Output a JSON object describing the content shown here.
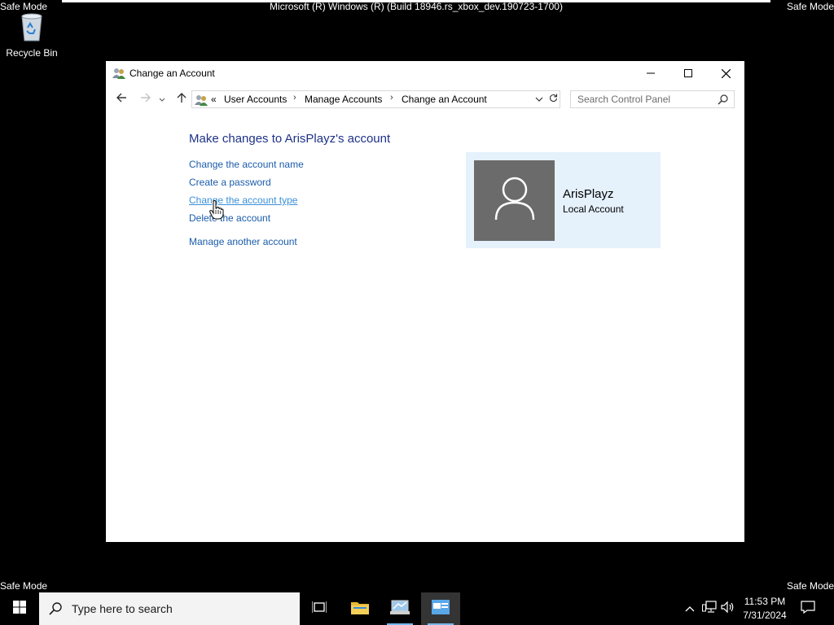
{
  "desktop": {
    "safe_mode_label": "Safe Mode",
    "build_text": "Microsoft (R) Windows (R) (Build 18946.rs_xbox_dev.190723-1700)",
    "recycle_bin_label": "Recycle Bin"
  },
  "window": {
    "title": "Change an Account",
    "controls": {
      "minimize_icon": "minimize-icon",
      "maximize_icon": "maximize-icon",
      "close_icon": "close-icon"
    },
    "address_bar": {
      "overflow_chevron": "«",
      "breadcrumbs": [
        "User Accounts",
        "Manage Accounts",
        "Change an Account"
      ],
      "separator": "›"
    },
    "search": {
      "placeholder": "Search Control Panel"
    },
    "heading": "Make changes to ArisPlayz's account",
    "links": {
      "change_name": "Change the account name",
      "create_password": "Create a password",
      "change_type": "Change the account type",
      "delete_account": "Delete the account",
      "manage_another": "Manage another account"
    },
    "account_card": {
      "name": "ArisPlayz",
      "type": "Local Account"
    }
  },
  "taskbar": {
    "search_placeholder": "Type here to search",
    "clock_time": "11:53 PM",
    "clock_date": "7/31/2024"
  },
  "colors": {
    "link": "#1a5caa",
    "link_hover": "#3a8fd8",
    "heading": "#1e3287",
    "card_bg": "#e5f1fb",
    "avatar_bg": "#6b6b6b",
    "taskbar_bg": "#000000",
    "active_indicator": "#76b9ed"
  }
}
